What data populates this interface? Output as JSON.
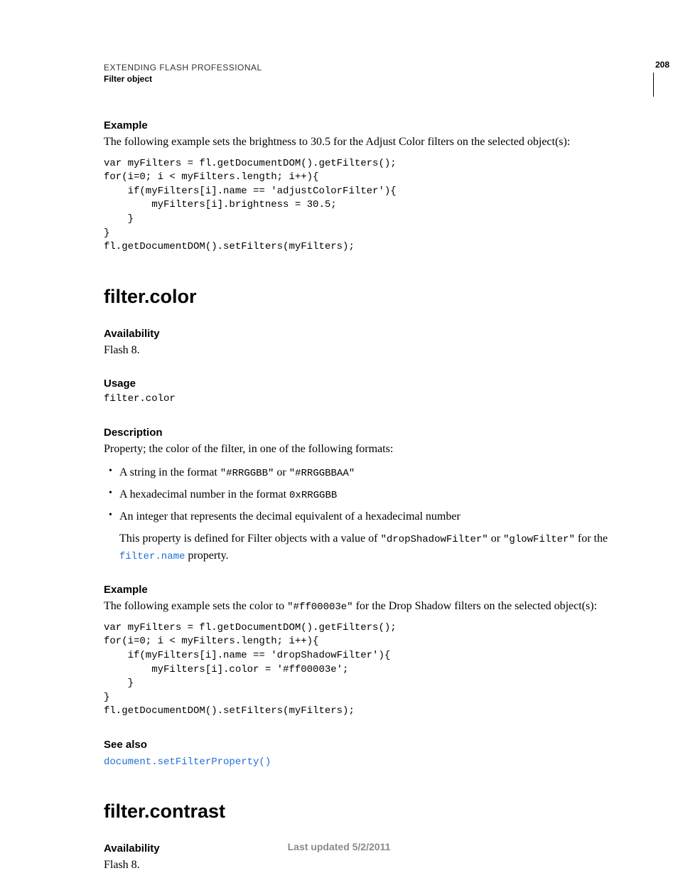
{
  "header": {
    "doc_title": "EXTENDING FLASH PROFESSIONAL",
    "chapter": "Filter object",
    "page_number": "208"
  },
  "sec_example1": {
    "heading": "Example",
    "intro": "The following example sets the brightness to 30.5 for the Adjust Color filters on the selected object(s):",
    "code": "var myFilters = fl.getDocumentDOM().getFilters();\nfor(i=0; i < myFilters.length; i++){\n    if(myFilters[i].name == 'adjustColorFilter'){\n        myFilters[i].brightness = 30.5;\n    }\n}\nfl.getDocumentDOM().setFilters(myFilters);"
  },
  "sec_color": {
    "title": "filter.color",
    "avail_h": "Availability",
    "avail_t": "Flash 8.",
    "usage_h": "Usage",
    "usage_code": "filter.color",
    "desc_h": "Description",
    "desc_intro": "Property; the color of the filter, in one of the following formats:",
    "bullet1_pre": "A string in the format ",
    "bullet1_c1": "\"#RRGGBB\"",
    "bullet1_mid": " or ",
    "bullet1_c2": "\"#RRGGBBAA\"",
    "bullet2_pre": "A hexadecimal number in the format ",
    "bullet2_c": "0xRRGGBB",
    "bullet3": "An integer that represents the decimal equivalent of a hexadecimal number",
    "sub_pre": "This property is defined for Filter objects with a value of ",
    "sub_c1": "\"dropShadowFilter\"",
    "sub_mid1": " or ",
    "sub_c2": "\"glowFilter\"",
    "sub_mid2": " for the ",
    "sub_link": "filter.name",
    "sub_post": " property.",
    "ex_h": "Example",
    "ex_pre": "The following example sets the color to ",
    "ex_c": "\"#ff00003e\"",
    "ex_post": " for the Drop Shadow filters on the selected object(s):",
    "ex_code": "var myFilters = fl.getDocumentDOM().getFilters();\nfor(i=0; i < myFilters.length; i++){\n    if(myFilters[i].name == 'dropShadowFilter'){\n        myFilters[i].color = '#ff00003e';\n    }\n}\nfl.getDocumentDOM().setFilters(myFilters);",
    "see_h": "See also",
    "see_link": "document.setFilterProperty()"
  },
  "sec_contrast": {
    "title": "filter.contrast",
    "avail_h": "Availability",
    "avail_t": "Flash 8."
  },
  "footer": "Last updated 5/2/2011"
}
